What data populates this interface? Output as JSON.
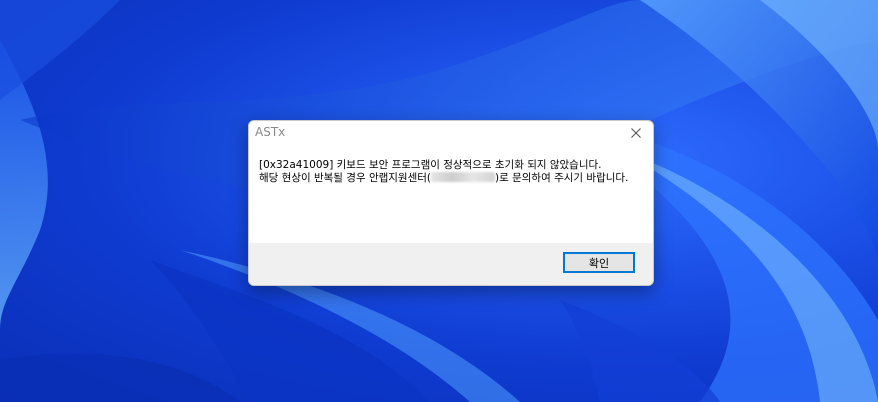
{
  "dialog": {
    "title": "ASTx",
    "close_icon": "close-icon",
    "message_line1": "[0x32a41009] 키보드 보안 프로그램이 정상적으로 초기화 되지 않았습니다.",
    "message_line2_before": "해당 현상이 반복될 경우 안랩지원센터(",
    "message_line2_after": ")로 문의하여 주시기 바랍니다.",
    "ok_label": "확인",
    "accent_color": "#0078d4"
  }
}
